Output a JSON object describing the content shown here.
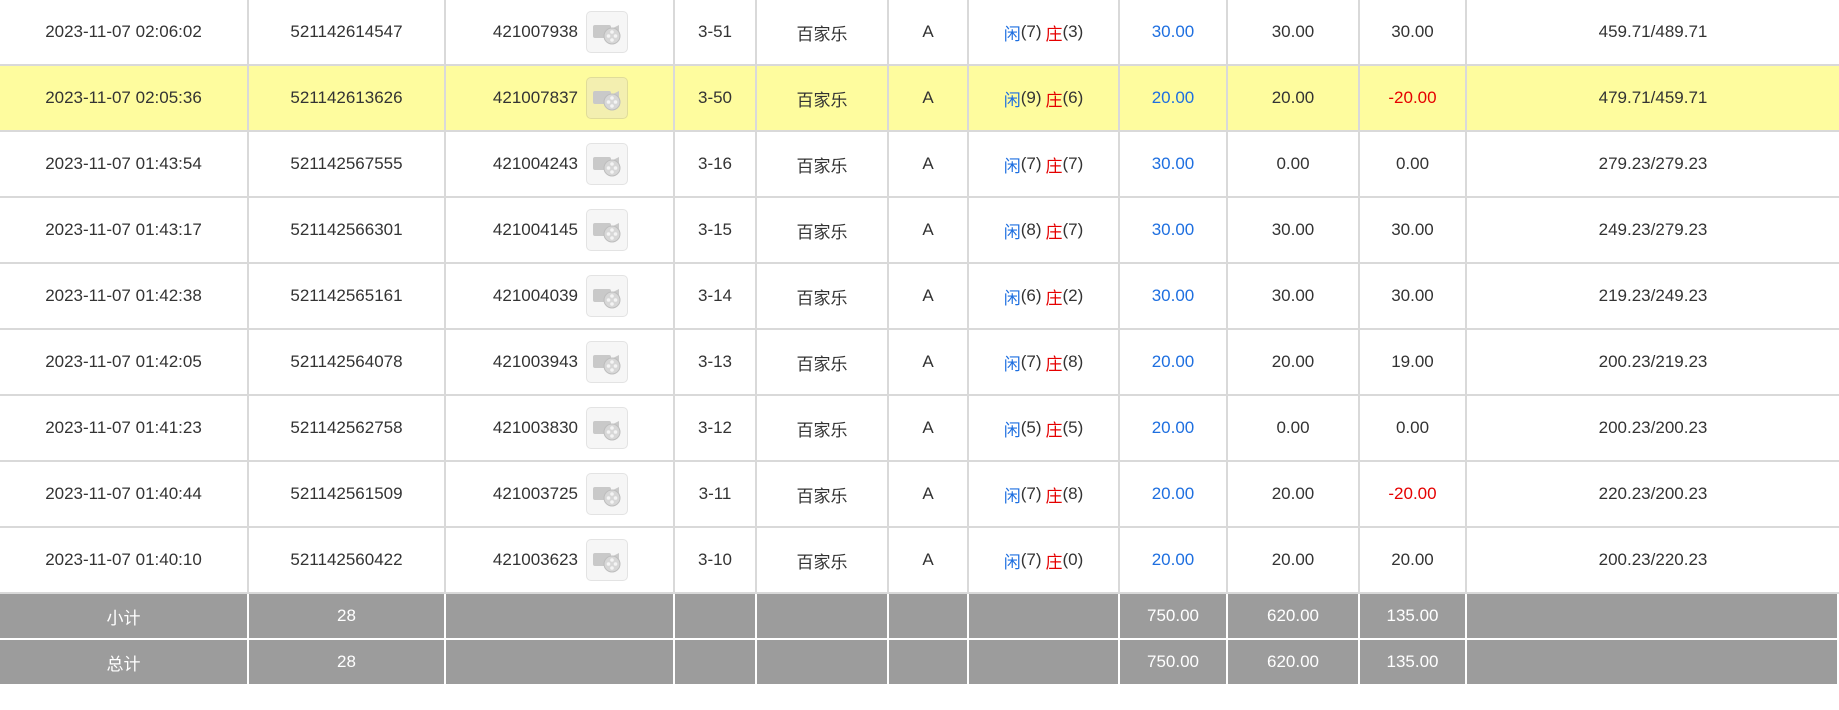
{
  "rows": [
    {
      "time": "2023-11-07 02:06:02",
      "order_no": "521142614547",
      "game_no": "421007938",
      "round": "3-51",
      "game": "百家乐",
      "table": "A",
      "player_label": "闲",
      "player_pts": "(7)",
      "banker_label": "庄",
      "banker_pts": "(3)",
      "bet": "30.00",
      "valid_bet": "30.00",
      "win_loss": "30.00",
      "win_loss_color": "normal",
      "balance": "459.71/489.71",
      "highlight": false
    },
    {
      "time": "2023-11-07 02:05:36",
      "order_no": "521142613626",
      "game_no": "421007837",
      "round": "3-50",
      "game": "百家乐",
      "table": "A",
      "player_label": "闲",
      "player_pts": "(9)",
      "banker_label": "庄",
      "banker_pts": "(6)",
      "bet": "20.00",
      "valid_bet": "20.00",
      "win_loss": "-20.00",
      "win_loss_color": "red",
      "balance": "479.71/459.71",
      "highlight": true
    },
    {
      "time": "2023-11-07 01:43:54",
      "order_no": "521142567555",
      "game_no": "421004243",
      "round": "3-16",
      "game": "百家乐",
      "table": "A",
      "player_label": "闲",
      "player_pts": "(7)",
      "banker_label": "庄",
      "banker_pts": "(7)",
      "bet": "30.00",
      "valid_bet": "0.00",
      "win_loss": "0.00",
      "win_loss_color": "normal",
      "balance": "279.23/279.23",
      "highlight": false
    },
    {
      "time": "2023-11-07 01:43:17",
      "order_no": "521142566301",
      "game_no": "421004145",
      "round": "3-15",
      "game": "百家乐",
      "table": "A",
      "player_label": "闲",
      "player_pts": "(8)",
      "banker_label": "庄",
      "banker_pts": "(7)",
      "bet": "30.00",
      "valid_bet": "30.00",
      "win_loss": "30.00",
      "win_loss_color": "normal",
      "balance": "249.23/279.23",
      "highlight": false
    },
    {
      "time": "2023-11-07 01:42:38",
      "order_no": "521142565161",
      "game_no": "421004039",
      "round": "3-14",
      "game": "百家乐",
      "table": "A",
      "player_label": "闲",
      "player_pts": "(6)",
      "banker_label": "庄",
      "banker_pts": "(2)",
      "bet": "30.00",
      "valid_bet": "30.00",
      "win_loss": "30.00",
      "win_loss_color": "normal",
      "balance": "219.23/249.23",
      "highlight": false
    },
    {
      "time": "2023-11-07 01:42:05",
      "order_no": "521142564078",
      "game_no": "421003943",
      "round": "3-13",
      "game": "百家乐",
      "table": "A",
      "player_label": "闲",
      "player_pts": "(7)",
      "banker_label": "庄",
      "banker_pts": "(8)",
      "bet": "20.00",
      "valid_bet": "20.00",
      "win_loss": "19.00",
      "win_loss_color": "normal",
      "balance": "200.23/219.23",
      "highlight": false
    },
    {
      "time": "2023-11-07 01:41:23",
      "order_no": "521142562758",
      "game_no": "421003830",
      "round": "3-12",
      "game": "百家乐",
      "table": "A",
      "player_label": "闲",
      "player_pts": "(5)",
      "banker_label": "庄",
      "banker_pts": "(5)",
      "bet": "20.00",
      "valid_bet": "0.00",
      "win_loss": "0.00",
      "win_loss_color": "normal",
      "balance": "200.23/200.23",
      "highlight": false
    },
    {
      "time": "2023-11-07 01:40:44",
      "order_no": "521142561509",
      "game_no": "421003725",
      "round": "3-11",
      "game": "百家乐",
      "table": "A",
      "player_label": "闲",
      "player_pts": "(7)",
      "banker_label": "庄",
      "banker_pts": "(8)",
      "bet": "20.00",
      "valid_bet": "20.00",
      "win_loss": "-20.00",
      "win_loss_color": "red",
      "balance": "220.23/200.23",
      "highlight": false
    },
    {
      "time": "2023-11-07 01:40:10",
      "order_no": "521142560422",
      "game_no": "421003623",
      "round": "3-10",
      "game": "百家乐",
      "table": "A",
      "player_label": "闲",
      "player_pts": "(7)",
      "banker_label": "庄",
      "banker_pts": "(0)",
      "bet": "20.00",
      "valid_bet": "20.00",
      "win_loss": "20.00",
      "win_loss_color": "normal",
      "balance": "200.23/220.23",
      "highlight": false
    }
  ],
  "summary": [
    {
      "label": "小计",
      "count": "28",
      "bet": "750.00",
      "valid_bet": "620.00",
      "win_loss": "135.00"
    },
    {
      "label": "总计",
      "count": "28",
      "bet": "750.00",
      "valid_bet": "620.00",
      "win_loss": "135.00"
    }
  ],
  "icons": {
    "video": "film-reel-icon"
  },
  "colors": {
    "player": "#1e6fe0",
    "banker": "#e50000",
    "loss": "#e50000",
    "highlight": "#fefc9e",
    "summary_bg": "#9c9c9c"
  }
}
